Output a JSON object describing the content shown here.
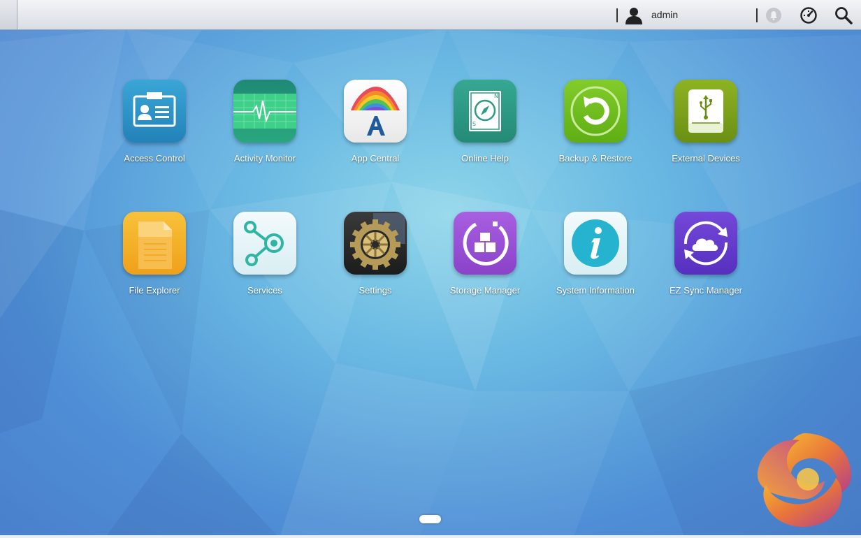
{
  "topbar": {
    "user": "admin",
    "icons": [
      "user-icon",
      "notification-bell-icon",
      "dashboard-gauge-icon",
      "search-icon"
    ]
  },
  "apps": [
    {
      "label": "Access Control",
      "icon": "access-control-icon",
      "color": "#2e95c8"
    },
    {
      "label": "Activity Monitor",
      "icon": "activity-monitor-icon",
      "color": "#2fae7a"
    },
    {
      "label": "App Central",
      "icon": "app-central-icon",
      "color": "#f3f3f3"
    },
    {
      "label": "Online Help",
      "icon": "online-help-icon",
      "color": "#2f9b86"
    },
    {
      "label": "Backup & Restore",
      "icon": "backup-restore-icon",
      "color": "#6fbf1e"
    },
    {
      "label": "External Devices",
      "icon": "external-devices-icon",
      "color": "#7aa11c"
    },
    {
      "label": "File Explorer",
      "icon": "file-explorer-icon",
      "color": "#f2a81c"
    },
    {
      "label": "Services",
      "icon": "services-icon",
      "color": "#e4f3f6"
    },
    {
      "label": "Settings",
      "icon": "settings-gear-icon",
      "color": "#2a2a2a"
    },
    {
      "label": "Storage Manager",
      "icon": "storage-manager-icon",
      "color": "#9a52d6"
    },
    {
      "label": "System Information",
      "icon": "system-information-icon",
      "color": "#e4f3f6"
    },
    {
      "label": "EZ Sync Manager",
      "icon": "ez-sync-manager-icon",
      "color": "#6a3fd0"
    }
  ],
  "colors": {
    "desktop_center": "#8fd6ea",
    "desktop_edge": "#4a7fcc",
    "topbar": "#e3e6eb"
  }
}
